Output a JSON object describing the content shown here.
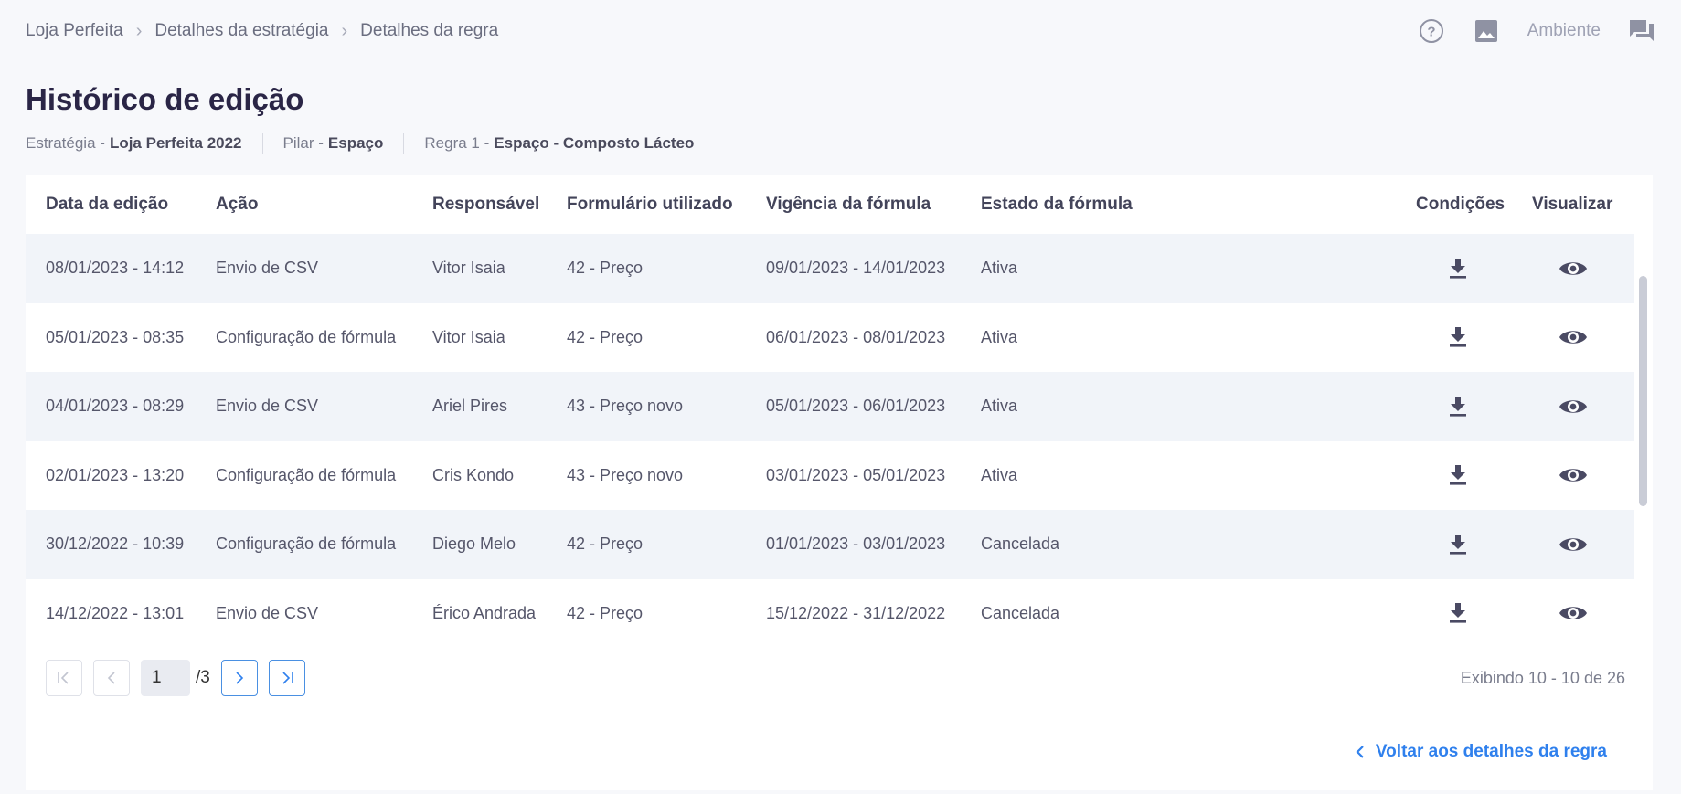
{
  "breadcrumb": [
    "Loja Perfeita",
    "Detalhes da estratégia",
    "Detalhes da regra"
  ],
  "topbar": {
    "environment_label": "Ambiente"
  },
  "page": {
    "title": "Histórico de edição",
    "meta": [
      {
        "label": "Estratégia -",
        "value": "Loja Perfeita 2022"
      },
      {
        "label": "Pilar -",
        "value": "Espaço"
      },
      {
        "label": "Regra 1 -",
        "value": "Espaço - Composto Lácteo"
      }
    ]
  },
  "table": {
    "headers": {
      "date": "Data da edição",
      "action": "Ação",
      "owner": "Responsável",
      "form": "Formulário utilizado",
      "validity": "Vigência da fórmula",
      "status": "Estado da fórmula",
      "conditions": "Condições",
      "view": "Visualizar"
    },
    "rows": [
      {
        "date": "08/01/2023 - 14:12",
        "action": "Envio de CSV",
        "owner": "Vitor Isaia",
        "form": "42 - Preço",
        "validity": "09/01/2023 - 14/01/2023",
        "status": "Ativa"
      },
      {
        "date": "05/01/2023 - 08:35",
        "action": "Configuração de fórmula",
        "owner": "Vitor Isaia",
        "form": "42 - Preço",
        "validity": "06/01/2023 - 08/01/2023",
        "status": "Ativa"
      },
      {
        "date": "04/01/2023 - 08:29",
        "action": "Envio de CSV",
        "owner": "Ariel Pires",
        "form": "43 - Preço novo",
        "validity": "05/01/2023 - 06/01/2023",
        "status": "Ativa"
      },
      {
        "date": "02/01/2023 - 13:20",
        "action": "Configuração de fórmula",
        "owner": "Cris Kondo",
        "form": "43 - Preço novo",
        "validity": "03/01/2023 - 05/01/2023",
        "status": "Ativa"
      },
      {
        "date": "30/12/2022 - 10:39",
        "action": "Configuração de fórmula",
        "owner": "Diego Melo",
        "form": "42 - Preço",
        "validity": "01/01/2023 - 03/01/2023",
        "status": "Cancelada"
      },
      {
        "date": "14/12/2022 - 13:01",
        "action": "Envio de CSV",
        "owner": "Érico Andrada",
        "form": "42 - Preço",
        "validity": "15/12/2022 - 31/12/2022",
        "status": "Cancelada"
      }
    ]
  },
  "pagination": {
    "current_page": "1",
    "total": "/3",
    "showing": "Exibindo 10 - 10 de 26"
  },
  "footer": {
    "back_label": "Voltar aos detalhes da regra"
  },
  "colors": {
    "accent": "#2f80ed",
    "title": "#2a2546",
    "icon": "#4a4a63"
  },
  "icons": [
    "help-icon",
    "image-icon",
    "chat-icon",
    "download-icon",
    "eye-icon",
    "first-page-icon",
    "prev-page-icon",
    "next-page-icon",
    "last-page-icon",
    "chevron-left-icon"
  ]
}
